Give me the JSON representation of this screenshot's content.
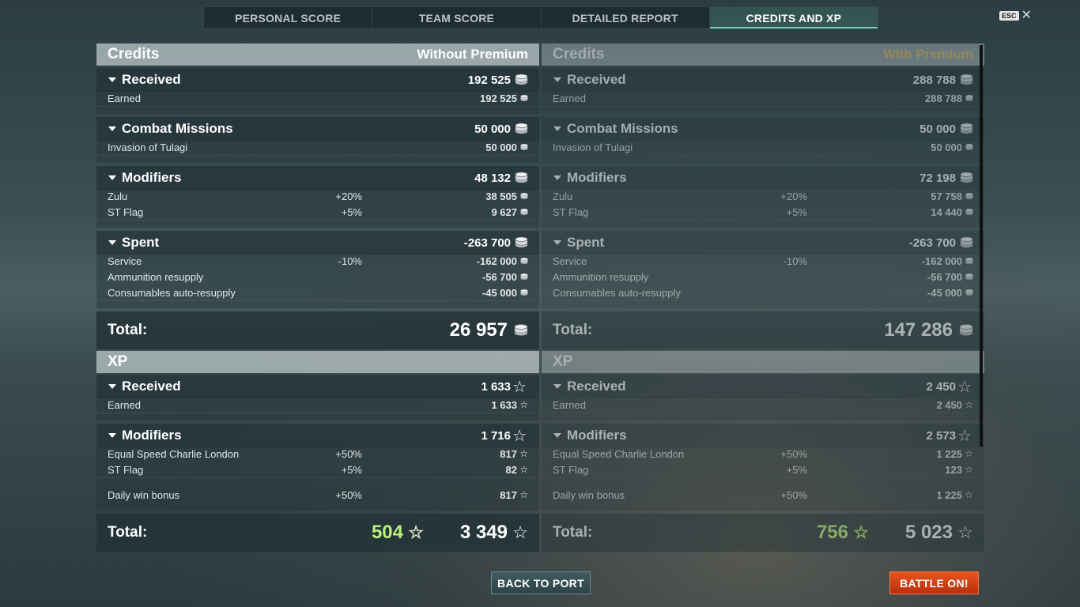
{
  "tabs": [
    "PERSONAL SCORE",
    "TEAM SCORE",
    "DETAILED REPORT",
    "CREDITS AND XP"
  ],
  "esc": {
    "key": "ESC"
  },
  "left": {
    "credits_title": "Credits",
    "credits_mode": "Without Premium",
    "received": {
      "label": "Received",
      "value": "192 525",
      "items": [
        {
          "label": "Earned",
          "value": "192 525"
        }
      ]
    },
    "missions": {
      "label": "Combat Missions",
      "value": "50 000",
      "items": [
        {
          "label": "Invasion of Tulagi",
          "value": "50 000"
        }
      ]
    },
    "modifiers": {
      "label": "Modifiers",
      "value": "48 132",
      "items": [
        {
          "label": "Zulu",
          "pct": "+20%",
          "value": "38 505"
        },
        {
          "label": "ST Flag",
          "pct": "+5%",
          "value": "9 627"
        }
      ]
    },
    "spent": {
      "label": "Spent",
      "value": "-263 700",
      "items": [
        {
          "label": "Service",
          "pct": "-10%",
          "value": "-162 000"
        },
        {
          "label": "Ammunition resupply",
          "value": "-56 700"
        },
        {
          "label": "Consumables auto-resupply",
          "value": "-45 000"
        }
      ]
    },
    "credits_total": {
      "label": "Total:",
      "value": "26 957"
    },
    "xp_title": "XP",
    "xp_received": {
      "label": "Received",
      "value": "1 633",
      "items": [
        {
          "label": "Earned",
          "value": "1 633"
        }
      ]
    },
    "xp_modifiers": {
      "label": "Modifiers",
      "value": "1 716",
      "items": [
        {
          "label": "Equal Speed Charlie London",
          "pct": "+50%",
          "value": "817"
        },
        {
          "label": "ST Flag",
          "pct": "+5%",
          "value": "82"
        },
        {
          "label": "Daily win bonus",
          "pct": "+50%",
          "value": "817"
        }
      ]
    },
    "xp_total": {
      "label": "Total:",
      "bonus": "504",
      "value": "3 349"
    }
  },
  "right": {
    "credits_title": "Credits",
    "credits_mode": "With Premium",
    "received": {
      "label": "Received",
      "value": "288 788",
      "items": [
        {
          "label": "Earned",
          "value": "288 788"
        }
      ]
    },
    "missions": {
      "label": "Combat Missions",
      "value": "50 000",
      "items": [
        {
          "label": "Invasion of Tulagi",
          "value": "50 000"
        }
      ]
    },
    "modifiers": {
      "label": "Modifiers",
      "value": "72 198",
      "items": [
        {
          "label": "Zulu",
          "pct": "+20%",
          "value": "57 758"
        },
        {
          "label": "ST Flag",
          "pct": "+5%",
          "value": "14 440"
        }
      ]
    },
    "spent": {
      "label": "Spent",
      "value": "-263 700",
      "items": [
        {
          "label": "Service",
          "pct": "-10%",
          "value": "-162 000"
        },
        {
          "label": "Ammunition resupply",
          "value": "-56 700"
        },
        {
          "label": "Consumables auto-resupply",
          "value": "-45 000"
        }
      ]
    },
    "credits_total": {
      "label": "Total:",
      "value": "147 286"
    },
    "xp_title": "XP",
    "xp_received": {
      "label": "Received",
      "value": "2 450",
      "items": [
        {
          "label": "Earned",
          "value": "2 450"
        }
      ]
    },
    "xp_modifiers": {
      "label": "Modifiers",
      "value": "2 573",
      "items": [
        {
          "label": "Equal Speed Charlie London",
          "pct": "+50%",
          "value": "1 225"
        },
        {
          "label": "ST Flag",
          "pct": "+5%",
          "value": "123"
        },
        {
          "label": "Daily win bonus",
          "pct": "+50%",
          "value": "1 225"
        }
      ]
    },
    "xp_total": {
      "label": "Total:",
      "bonus": "756",
      "value": "5 023"
    }
  },
  "buttons": {
    "back": "BACK TO PORT",
    "battle": "BATTLE ON!"
  },
  "colors": {
    "accent": "#6fd1b8",
    "premium": "#e8c070",
    "bonus_xp": "#b7f07a",
    "battle": "#d8431a"
  }
}
